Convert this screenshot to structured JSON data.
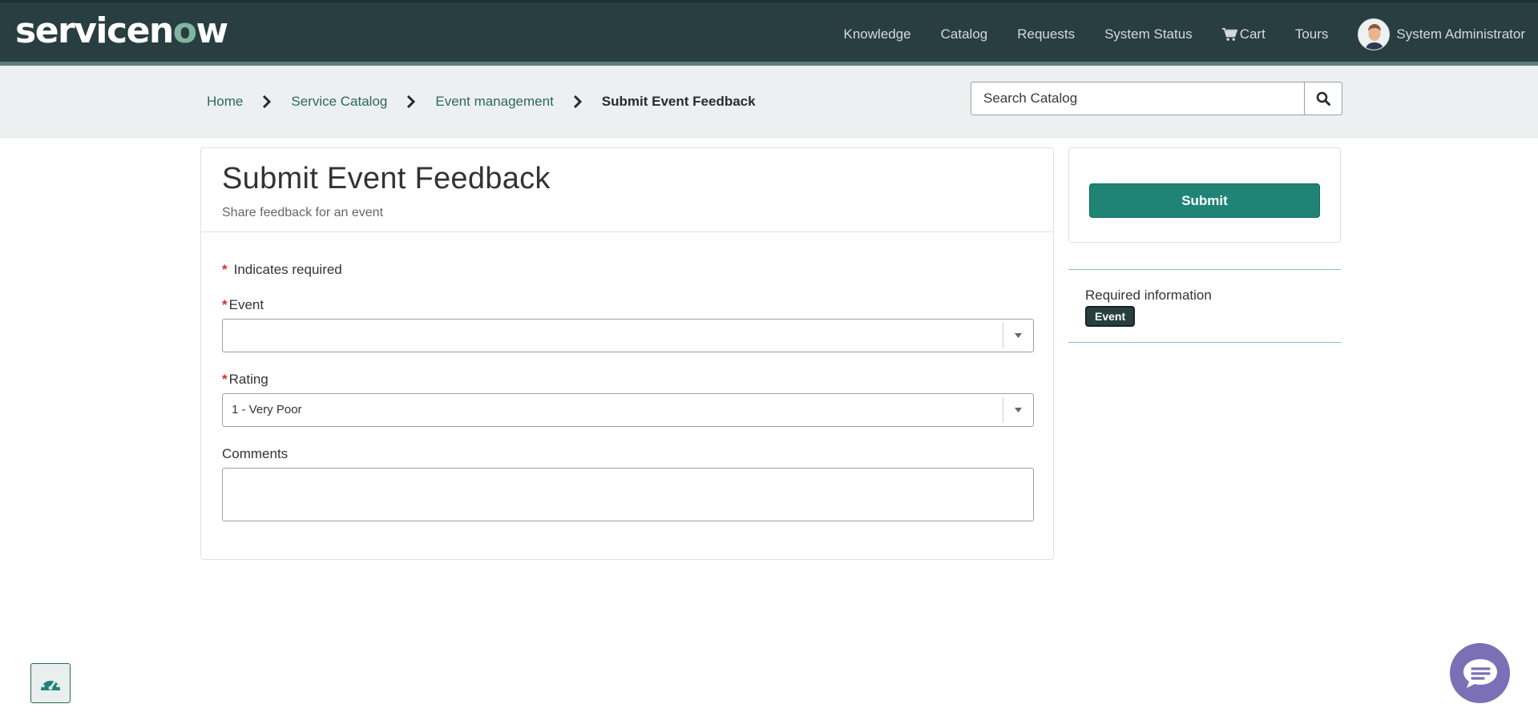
{
  "header": {
    "logo_text": "servicenow",
    "nav": {
      "knowledge": "Knowledge",
      "catalog": "Catalog",
      "requests": "Requests",
      "system_status": "System Status",
      "cart": "Cart",
      "tours": "Tours",
      "user": "System Administrator"
    }
  },
  "breadcrumb": {
    "items": [
      "Home",
      "Service Catalog",
      "Event management"
    ],
    "current": "Submit Event Feedback"
  },
  "search": {
    "placeholder": "Search Catalog"
  },
  "form": {
    "title": "Submit Event Feedback",
    "subtitle": "Share feedback for an event",
    "required_note": "Indicates required",
    "required_star": "*",
    "fields": {
      "event": {
        "label": "Event",
        "value": ""
      },
      "rating": {
        "label": "Rating",
        "value": "1 - Very Poor"
      },
      "comments": {
        "label": "Comments",
        "value": ""
      }
    }
  },
  "sidebar": {
    "submit_label": "Submit",
    "required_info_title": "Required information",
    "required_badges": [
      "Event"
    ]
  },
  "colors": {
    "header_bg": "#293e40",
    "accent_green": "#1f8476",
    "link_green": "#2a6a5b",
    "required_red": "#d22d2d",
    "chat_purple": "#7b6fb5"
  },
  "icons": [
    "cart-icon",
    "avatar",
    "chevron-right-icon",
    "search-icon",
    "chevron-down-icon",
    "dashboard-icon",
    "chat-icon"
  ]
}
